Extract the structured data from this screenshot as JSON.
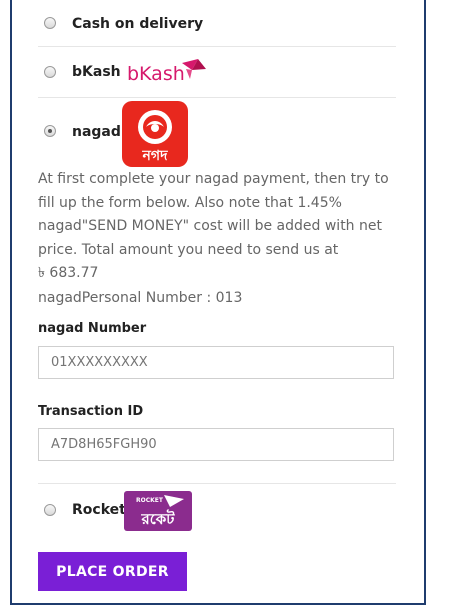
{
  "payment_methods": {
    "cod": {
      "label": "Cash on delivery",
      "selected": false
    },
    "bkash": {
      "label": "bKash",
      "logo_text": "bKash",
      "selected": false
    },
    "nagad": {
      "label": "nagad",
      "logo_text": "নগদ",
      "selected": true
    },
    "rocket": {
      "label": "Rocket",
      "logo_text": "ROCKET",
      "logo_script": "রকেট",
      "selected": false
    }
  },
  "nagad_details": {
    "instructions": [
      "At first complete your nagad payment, then try to",
      "fill up the form below. Also note that 1.45%",
      "nagad\"SEND MONEY\" cost will be added with net",
      "price. Total amount you need to send us at",
      "৳ 683.77"
    ],
    "personal_number": "nagadPersonal Number : 013",
    "number_label": "nagad Number",
    "number_placeholder": "01XXXXXXXXX",
    "transaction_label": "Transaction ID",
    "transaction_placeholder": "A7D8H65FGH90"
  },
  "place_order_label": "PLACE ORDER",
  "colors": {
    "frame": "#1f3c6e",
    "button": "#7a1fd6",
    "nagad": "#e8281e",
    "rocket": "#8b2c8e",
    "bkash": "#d6196c"
  }
}
